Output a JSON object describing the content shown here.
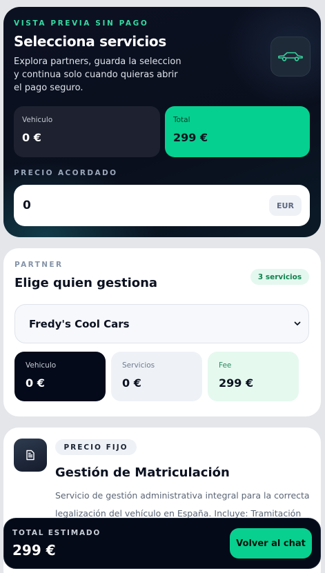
{
  "hero": {
    "eyebrow": "VISTA PREVIA SIN PAGO",
    "title": "Selecciona servicios",
    "description": "Explora partners, guarda la seleccion y continua solo cuando quieras abrir el pago seguro.",
    "icon": "car-icon",
    "vehicle_label": "Vehiculo",
    "vehicle_value": "0 €",
    "total_label": "Total",
    "total_value": "299 €",
    "price_label": "PRECIO ACORDADO",
    "price_value": "0",
    "currency": "EUR"
  },
  "partner": {
    "eyebrow": "PARTNER",
    "title": "Elige quien gestiona",
    "services_badge": "3 servicios",
    "selected": "Fredy's Cool Cars",
    "vehicle_label": "Vehiculo",
    "vehicle_value": "0 €",
    "services_label": "Servicios",
    "services_value": "0 €",
    "fee_label": "Fee",
    "fee_value": "299 €"
  },
  "service": {
    "icon": "document-icon",
    "badge": "PRECIO FIJO",
    "title": "Gestión de Matriculación",
    "description": "Servicio de gestión administrativa integral para la correcta legalización del vehículo en España. Incluye: Tramitación de"
  },
  "footer": {
    "total_label": "TOTAL ESTIMADO",
    "total_value": "299 €",
    "button_label": "Volver al chat"
  },
  "colors": {
    "accent_green": "#06d08f",
    "dark_navy": "#0a0f1d"
  }
}
